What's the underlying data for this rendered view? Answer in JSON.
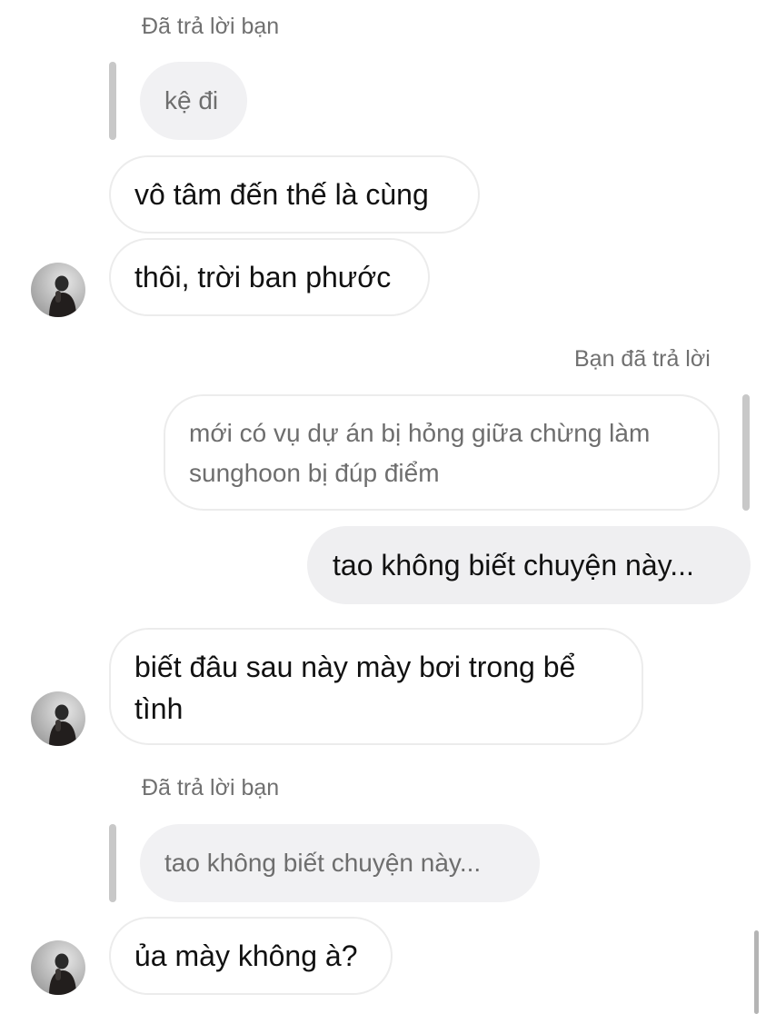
{
  "conversation": {
    "messages": [
      {
        "reply_caption": "Đã trả lời bạn",
        "quoted_text": "kệ đi"
      },
      {
        "text": "vô tâm đến thế là cùng"
      },
      {
        "text": "thôi, trời ban phước"
      },
      {
        "reply_caption": "Bạn đã trả lời",
        "quoted_text": "mới có vụ dự án bị hỏng giữa chừng làm sunghoon bị đúp điểm"
      },
      {
        "text": "tao không biết chuyện này..."
      },
      {
        "text": "biết đâu sau này mày bơi trong bể tình"
      },
      {
        "reply_caption": "Đã trả lời bạn",
        "quoted_text": "tao không biết chuyện này..."
      },
      {
        "text": "ủa mày không à?"
      }
    ]
  },
  "colors": {
    "background": "#ffffff",
    "incoming_bubble_border": "#ececec",
    "outgoing_bubble": "#efeff1",
    "quoted_bubble": "#f1f1f3",
    "quote_bar": "#c8c8c8",
    "caption_text": "#707070",
    "message_text": "#111111"
  },
  "icons": {
    "avatar": "user-avatar"
  }
}
